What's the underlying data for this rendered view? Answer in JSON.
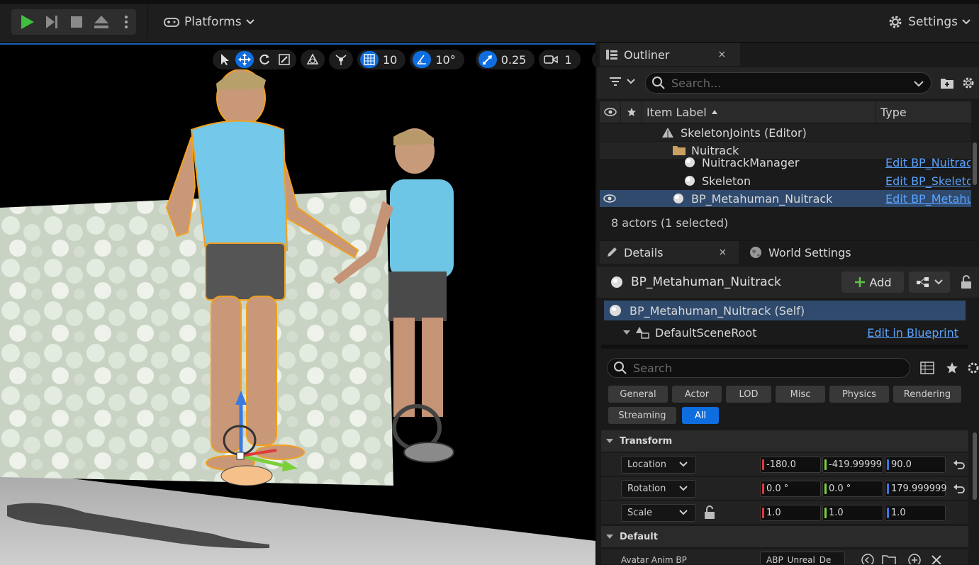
{
  "toolbar": {
    "platforms_label": "Platforms",
    "settings_label": "Settings"
  },
  "viewport": {
    "grid_snap": "10",
    "rotation_snap": "10°",
    "scale_snap": "0.25",
    "camera_speed": "1"
  },
  "outliner": {
    "tab_label": "Outliner",
    "close": "×",
    "search_placeholder": "Search...",
    "col_label": "Item Label",
    "col_type": "Type",
    "rows": [
      {
        "label": "SkeletonJoints (Editor)",
        "type": ""
      },
      {
        "label": "Nuitrack",
        "type": ""
      },
      {
        "label": "NuitrackManager",
        "type": "Edit BP_Nuitrac"
      },
      {
        "label": "Skeleton",
        "type": "Edit BP_Skeleto"
      },
      {
        "label": "BP_Metahuman_Nuitrack",
        "type": "Edit BP_Metahu"
      }
    ],
    "footer": "8 actors (1 selected)"
  },
  "details": {
    "tab_label": "Details",
    "close": "×",
    "world_settings_label": "World Settings",
    "actor_name": "BP_Metahuman_Nuitrack",
    "add_label": "Add",
    "components": [
      {
        "label": "BP_Metahuman_Nuitrack (Self)",
        "link": ""
      },
      {
        "label": "DefaultSceneRoot",
        "link": "Edit in Blueprint"
      }
    ],
    "search_placeholder": "Search",
    "filters": [
      "General",
      "Actor",
      "LOD",
      "Misc",
      "Physics",
      "Rendering",
      "Streaming",
      "All"
    ],
    "transform_section": "Transform",
    "location_label": "Location",
    "location": [
      "-180.0",
      "-419.99999",
      "90.0"
    ],
    "rotation_label": "Rotation",
    "rotation": [
      "0.0 °",
      "0.0 °",
      "179.999999"
    ],
    "scale_label": "Scale",
    "scale": [
      "1.0",
      "1.0",
      "1.0"
    ],
    "default_section": "Default",
    "avatar_anim_label": "Avatar Anim BP",
    "avatar_anim_value": "ABP_Unreal_De"
  },
  "colors": {
    "accent": "#0e6ee0",
    "selection": "#2f4a6d",
    "link": "#5aa3ff",
    "x_axis": "#e03a3a",
    "y_axis": "#7ad03a",
    "z_axis": "#3a7ae0"
  }
}
